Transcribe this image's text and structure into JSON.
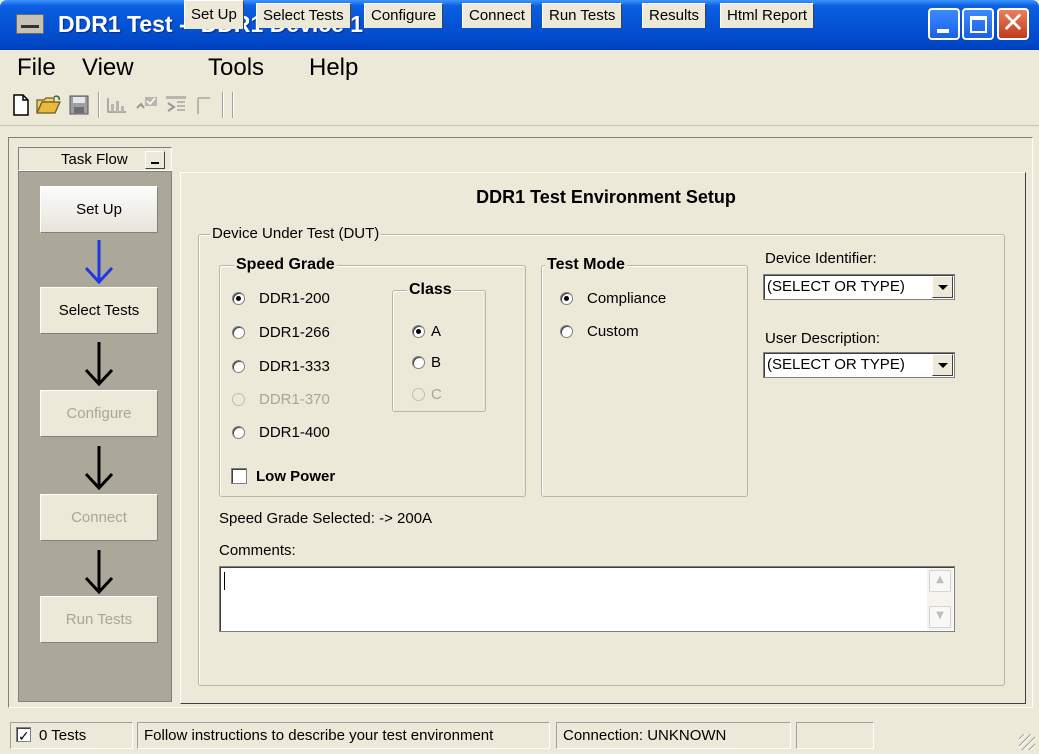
{
  "window": {
    "title": "DDR1 Test -- DDR1 Device 1",
    "controls": [
      "minimize-icon",
      "maximize-icon",
      "close-icon"
    ],
    "close_glyph": "✕"
  },
  "menu": {
    "items": [
      "File",
      "View",
      "Tools",
      "Help"
    ]
  },
  "toolbar": {
    "icons": [
      "new-icon",
      "open-icon",
      "save-icon",
      "chart-icon",
      "check-icon",
      "list-icon",
      "bracket-icon"
    ]
  },
  "taskflow": {
    "header": "Task Flow",
    "steps": [
      {
        "label": "Set Up",
        "state": "active"
      },
      {
        "label": "Select Tests",
        "state": "enabled"
      },
      {
        "label": "Configure",
        "state": "disabled"
      },
      {
        "label": "Connect",
        "state": "disabled"
      },
      {
        "label": "Run Tests",
        "state": "disabled"
      }
    ],
    "arrow_colors": [
      "#1f38e6",
      "#000000",
      "#000000",
      "#000000"
    ]
  },
  "tabs": [
    "Set Up",
    "Select Tests",
    "Configure",
    "Connect",
    "Run Tests",
    "Results",
    "Html Report"
  ],
  "active_tab": "Set Up",
  "setup": {
    "title": "DDR1 Test Environment Setup",
    "dut_group": "Device Under Test (DUT)",
    "speed_grade": {
      "label": "Speed Grade",
      "options": [
        {
          "label": "DDR1-200",
          "checked": true,
          "disabled": false
        },
        {
          "label": "DDR1-266",
          "checked": false,
          "disabled": false
        },
        {
          "label": "DDR1-333",
          "checked": false,
          "disabled": false
        },
        {
          "label": "DDR1-370",
          "checked": false,
          "disabled": true
        },
        {
          "label": "DDR1-400",
          "checked": false,
          "disabled": false
        }
      ],
      "low_power_label": "Low Power",
      "low_power_checked": false
    },
    "class": {
      "label": "Class",
      "options": [
        {
          "label": "A",
          "checked": true,
          "disabled": false
        },
        {
          "label": "B",
          "checked": false,
          "disabled": false
        },
        {
          "label": "C",
          "checked": false,
          "disabled": true
        }
      ]
    },
    "test_mode": {
      "label": "Test Mode",
      "options": [
        {
          "label": "Compliance",
          "checked": true
        },
        {
          "label": "Custom",
          "checked": false
        }
      ]
    },
    "device_identifier": {
      "label": "Device Identifier:",
      "value": "(SELECT OR TYPE)"
    },
    "user_description": {
      "label": "User Description:",
      "value": "(SELECT OR TYPE)"
    },
    "speed_grade_selected": "Speed Grade Selected: -> 200A",
    "comments_label": "Comments:",
    "comments_value": ""
  },
  "statusbar": {
    "tests": "0 Tests",
    "tests_checked": true,
    "message": "Follow instructions to describe your test environment",
    "connection": "Connection: UNKNOWN",
    "extra": ""
  }
}
